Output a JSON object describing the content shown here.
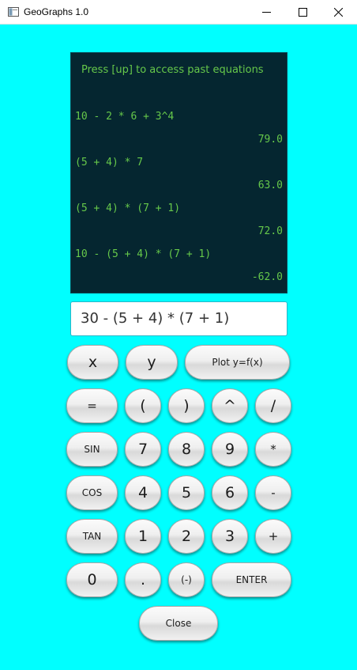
{
  "window": {
    "title": "GeoGraphs 1.0"
  },
  "console": {
    "hint": "Press [up] to access past equations",
    "history": [
      {
        "expr": "10 - 2 * 6 + 3^4",
        "result": "79.0"
      },
      {
        "expr": "(5 + 4) * 7",
        "result": "63.0"
      },
      {
        "expr": "(5 + 4) * (7 + 1)",
        "result": "72.0"
      },
      {
        "expr": "10 - (5 + 4) * (7 + 1)",
        "result": "-62.0"
      }
    ]
  },
  "input": {
    "value": "30 - (5 + 4) * (7 + 1)"
  },
  "keys": {
    "x": "x",
    "y": "y",
    "plot": "Plot y=f(x)",
    "eq": "=",
    "lparen": "(",
    "rparen": ")",
    "pow": "^",
    "div": "/",
    "sin": "SIN",
    "k7": "7",
    "k8": "8",
    "k9": "9",
    "mul": "*",
    "cos": "COS",
    "k4": "4",
    "k5": "5",
    "k6": "6",
    "sub": "-",
    "tan": "TAN",
    "k1": "1",
    "k2": "2",
    "k3": "3",
    "add": "+",
    "k0": "0",
    "dot": ".",
    "neg": "(-)",
    "enter": "ENTER",
    "close": "Close"
  },
  "colors": {
    "background": "#00FFFF",
    "console_bg": "#052630",
    "console_text": "#66C84A"
  }
}
